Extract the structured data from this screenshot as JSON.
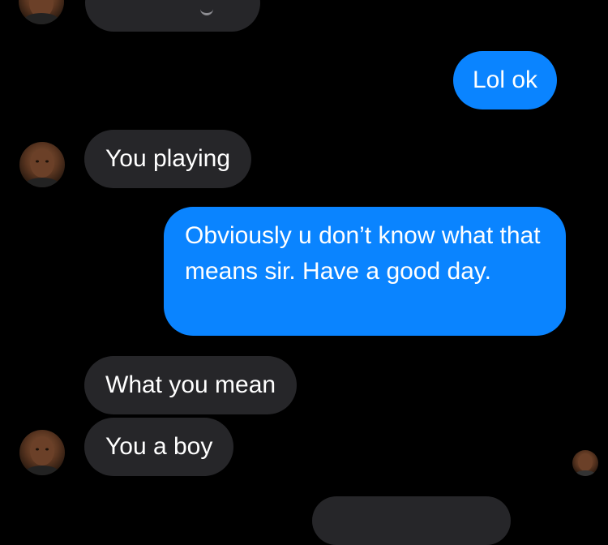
{
  "conversation": {
    "messages": [
      {
        "sender": "contact",
        "text": ""
      },
      {
        "sender": "me",
        "text": "Lol ok"
      },
      {
        "sender": "contact",
        "text": "You playing"
      },
      {
        "sender": "me",
        "text": "Obviously u don’t know what that means sir. Have a good day."
      },
      {
        "sender": "contact",
        "text": "What you mean"
      },
      {
        "sender": "contact",
        "text": "You a boy"
      },
      {
        "sender": "me",
        "text": ""
      }
    ]
  },
  "colors": {
    "background": "#000000",
    "incoming_bubble": "#262629",
    "outgoing_bubble": "#0a84ff",
    "text": "#ffffff"
  },
  "icons": {
    "contact_avatar": "contact-avatar-icon",
    "read_receipt_avatar": "read-receipt-avatar-icon"
  }
}
